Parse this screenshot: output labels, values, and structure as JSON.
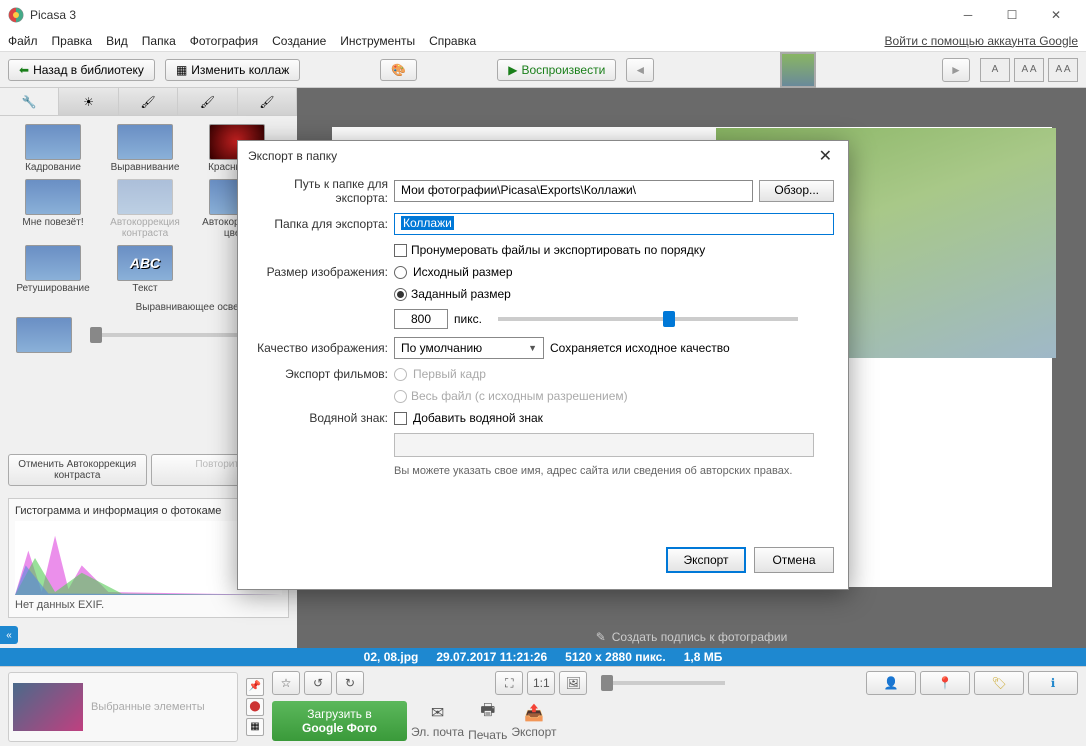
{
  "window": {
    "title": "Picasa 3"
  },
  "menu": {
    "file": "Файл",
    "edit": "Правка",
    "view": "Вид",
    "folder": "Папка",
    "photo": "Фотография",
    "create": "Создание",
    "tools": "Инструменты",
    "help": "Справка",
    "signin": "Войти с помощью аккаунта Google"
  },
  "toolbar": {
    "back": "Назад в библиотеку",
    "editcollage": "Изменить коллаж",
    "play": "Воспроизвести"
  },
  "crop_labels": {
    "a": "A",
    "aa": "A A"
  },
  "effects": {
    "crop": "Кадрование",
    "straighten": "Выравнивание",
    "redeye": "Красные гла",
    "lucky": "Мне повезёт!",
    "autocontrast": "Автокоррекция контраста",
    "autocolor": "Автокоррекция цвета",
    "retouch": "Ретуширование",
    "text": "Текст",
    "fill_light": "Выравнивающее освещение",
    "undo": "Отменить Автокоррекция контраста",
    "redo": "Повторить"
  },
  "histogram": {
    "title": "Гистограмма и информация о фотокаме",
    "noexif": "Нет данных EXIF."
  },
  "caption": "Создать подпись к фотографии",
  "info": {
    "filename": "02, 08.jpg",
    "date": "29.07.2017 11:21:26",
    "dims": "5120 x 2880 пикс.",
    "size": "1,8 МБ"
  },
  "bottom": {
    "selected": "Выбранные элементы",
    "upload": "Загрузить в",
    "upload2": "Google Фото",
    "email": "Эл. почта",
    "print": "Печать",
    "export": "Экспорт"
  },
  "dialog": {
    "title": "Экспорт в папку",
    "path_label": "Путь к папке для экспорта:",
    "path_value": "Мои фотографии\\Picasa\\Exports\\Коллажи\\",
    "browse": "Обзор...",
    "folder_label": "Папка для экспорта:",
    "folder_value": "Коллажи",
    "number_cb": "Пронумеровать файлы и экспортировать по порядку",
    "size_label": "Размер изображения:",
    "size_orig": "Исходный размер",
    "size_custom": "Заданный размер",
    "size_value": "800",
    "px": "пикс.",
    "quality_label": "Качество изображения:",
    "quality_combo": "По умолчанию",
    "quality_note": "Сохраняется исходное качество",
    "movies_label": "Экспорт фильмов:",
    "movies_first": "Первый кадр",
    "movies_whole": "Весь файл (с исходным разрешением)",
    "wm_label": "Водяной знак:",
    "wm_cb": "Добавить водяной знак",
    "wm_hint": "Вы можете указать свое имя, адрес сайта или сведения об авторских правах.",
    "ok": "Экспорт",
    "cancel": "Отмена"
  }
}
